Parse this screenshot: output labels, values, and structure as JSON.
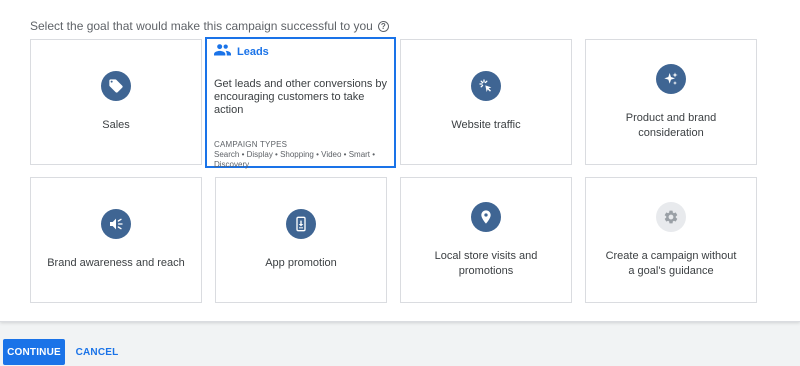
{
  "prompt": {
    "text": "Select the goal that would make this campaign successful to you",
    "help_icon": "?"
  },
  "goals": [
    {
      "label": "Sales",
      "icon": "tag-icon"
    },
    {
      "label": "Leads",
      "icon": "people-icon",
      "selected": true,
      "description": "Get leads and other conversions by encouraging customers to take action",
      "types_title": "CAMPAIGN TYPES",
      "types": "Search • Display • Shopping • Video • Smart • Discovery"
    },
    {
      "label": "Website traffic",
      "icon": "cursor-click-icon"
    },
    {
      "label": "Product and brand consideration",
      "icon": "sparkle-icon"
    },
    {
      "label": "Brand awareness and reach",
      "icon": "megaphone-icon"
    },
    {
      "label": "App promotion",
      "icon": "phone-download-icon"
    },
    {
      "label": "Local store visits and promotions",
      "icon": "location-pin-icon"
    },
    {
      "label": "Create a campaign without a goal's guidance",
      "icon": "gear-icon"
    }
  ],
  "actions": {
    "continue_label": "CONTINUE",
    "cancel_label": "CANCEL"
  },
  "colors": {
    "accent": "#1a73e8",
    "icon_circle": "#3f6593",
    "icon_circle_muted": "#e8eaed"
  }
}
